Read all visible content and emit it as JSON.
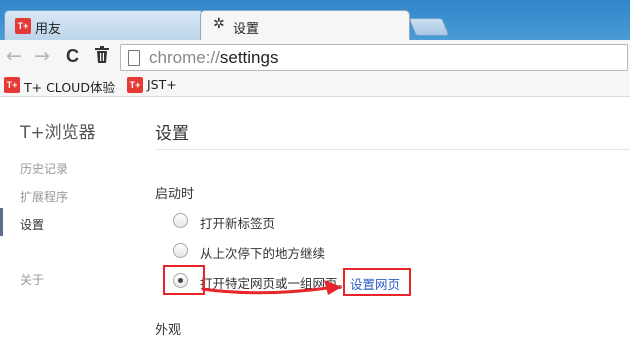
{
  "tabs": [
    {
      "title": "用友",
      "favicon": "T+"
    },
    {
      "title": "设置",
      "icon": "gear-icon"
    }
  ],
  "toolbar": {
    "back": "←",
    "forward": "→",
    "reload": "C",
    "delete": "🗑",
    "url_scheme": "chrome://",
    "url_host": "settings"
  },
  "bookmarks": [
    {
      "favicon": "T+",
      "label": "T+ CLOUD体验"
    },
    {
      "favicon": "T+",
      "label": "JST+"
    }
  ],
  "sidebar": {
    "brand": "T+浏览器",
    "items": [
      "历史记录",
      "扩展程序",
      "设置",
      "关于"
    ]
  },
  "main": {
    "title": "设置",
    "startup": {
      "title": "启动时",
      "options": [
        "打开新标签页",
        "从上次停下的地方继续",
        "打开特定网页或一组网页。"
      ],
      "selected_index": 2,
      "link": "设置网页"
    },
    "appearance_title": "外观"
  },
  "colors": {
    "tabstrip": "#2f86c9",
    "annotation": "#e8252b",
    "link": "#2a5cc5"
  }
}
